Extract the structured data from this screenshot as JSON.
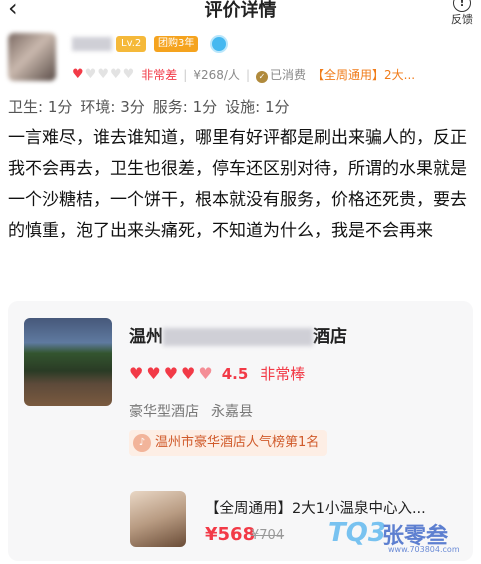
{
  "header": {
    "title": "评价详情",
    "back_icon": "chevron-left-icon",
    "feedback_label": "反馈",
    "feedback_icon": "warning-circle-icon"
  },
  "user": {
    "level_badge": "Lv.2",
    "groupbuy_badge": "团购3年",
    "rating_text": "非常差",
    "hearts_filled": 1,
    "hearts_total": 5,
    "price": "¥268/人",
    "consumed": "已消费",
    "deal_label": "【全周通用】2大..."
  },
  "scores": [
    "卫生: 1分",
    "环境: 3分",
    "服务: 1分",
    "设施: 1分"
  ],
  "review": "一言难尽，谁去谁知道，哪里有好评都是刷出来骗人的，反正我不会再去，卫生也很差，停车还区别对待，所谓的水果就是一个沙糖桔，一个饼干，根本就没有服务，价格还死贵，要去的慎重，泡了出来头痛死，不知道为什么，我是不会再来",
  "hotel": {
    "name_prefix": "温州",
    "name_suffix": "酒店",
    "score": "4.5",
    "score_text": "非常棒",
    "hearts_filled": 5,
    "type": "豪华型酒店",
    "area": "永嘉县",
    "rank": "温州市豪华酒店人气榜第1名"
  },
  "deal": {
    "title": "【全周通用】2大1小温泉中心入...",
    "price": "¥568",
    "old_price": "¥704"
  },
  "watermark": {
    "logo": "TQ3",
    "name": "张零叁",
    "url": "www.703804.com"
  },
  "colors": {
    "accent": "#f23a47",
    "orange": "#f07c1a"
  }
}
